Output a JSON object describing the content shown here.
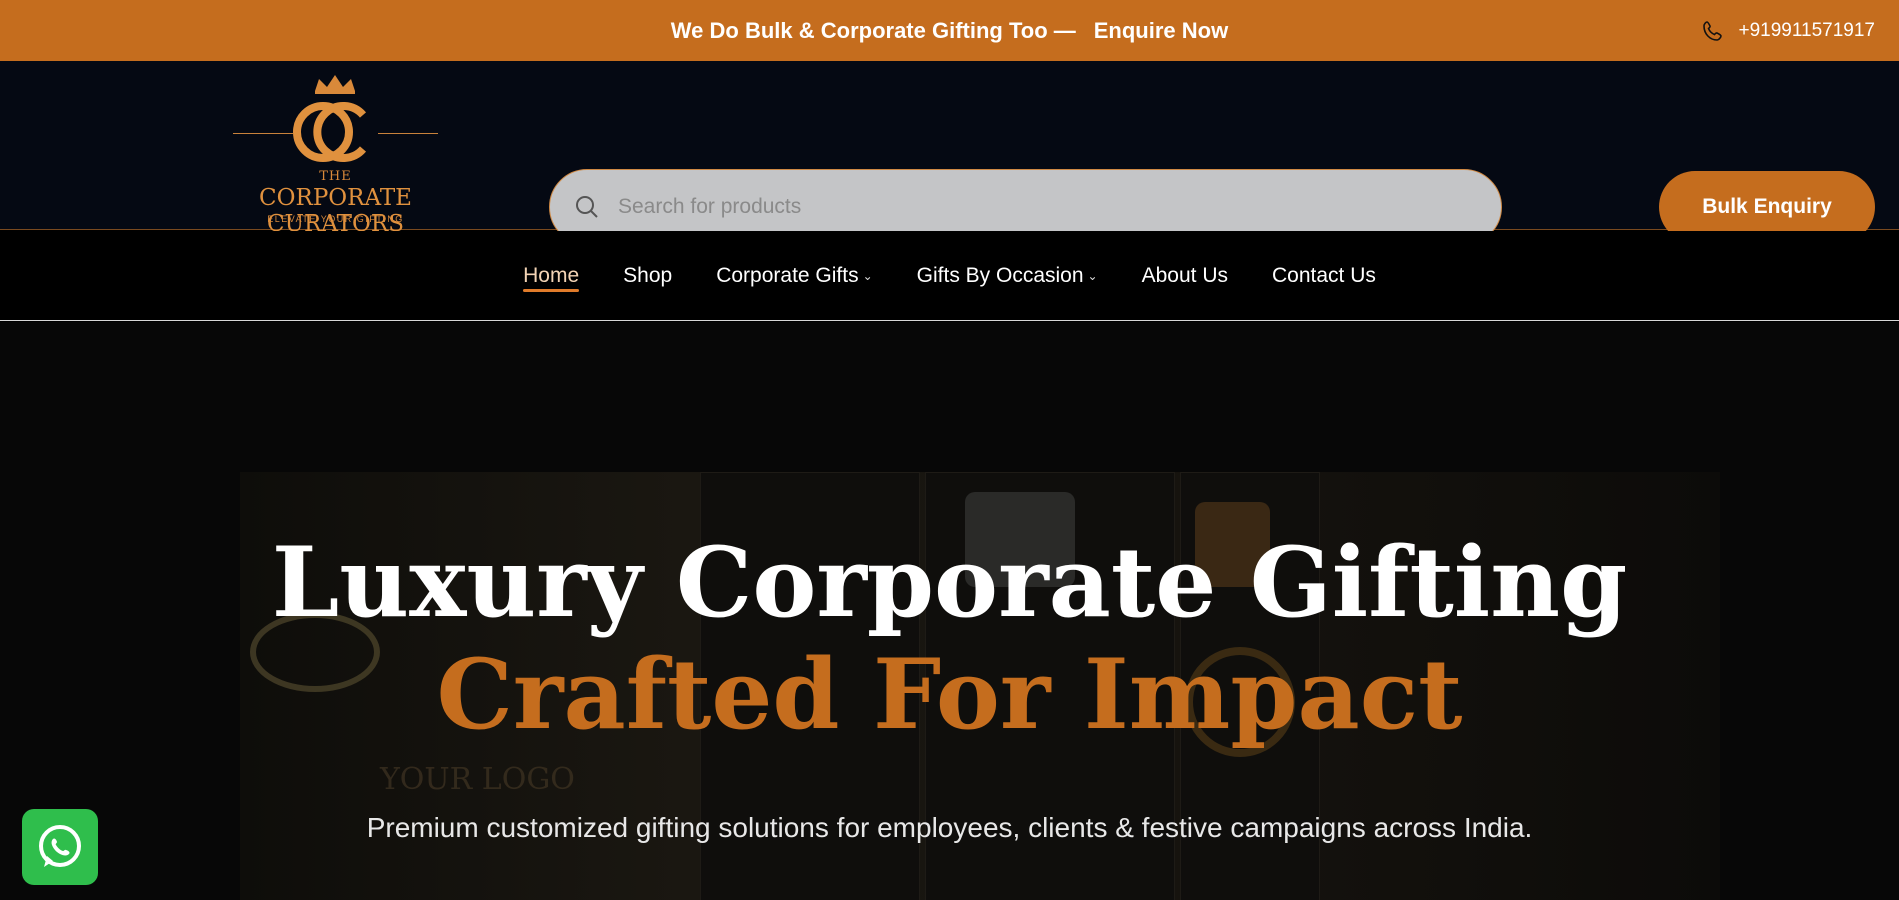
{
  "topbar": {
    "promo_text": "We Do Bulk & Corporate Gifting Too —",
    "promo_link": "Enquire Now",
    "phone": "+919911571917",
    "phone_icon": "phone-icon"
  },
  "logo": {
    "the": "THE",
    "name": "CORPORATE CURATORS",
    "tagline": "ELEVATE YOUR GIFTING"
  },
  "search": {
    "placeholder": "Search for products",
    "icon": "search-icon"
  },
  "header": {
    "bulk_button": "Bulk Enquiry"
  },
  "nav": {
    "items": [
      {
        "label": "Home",
        "active": true
      },
      {
        "label": "Shop"
      },
      {
        "label": "Corporate Gifts",
        "dropdown": true
      },
      {
        "label": "Gifts By Occasion",
        "dropdown": true
      },
      {
        "label": "About Us"
      },
      {
        "label": "Contact Us"
      }
    ]
  },
  "hero": {
    "title_line1": "Luxury Corporate Gifting",
    "title_line2": "Crafted For Impact",
    "subtitle": "Premium customized gifting solutions for employees, clients & festive campaigns across India.",
    "background_text": "YOUR LOGO"
  },
  "floating": {
    "whatsapp_icon": "whatsapp-icon"
  },
  "colors": {
    "accent": "#c56d1e",
    "header_bg": "#050913"
  }
}
